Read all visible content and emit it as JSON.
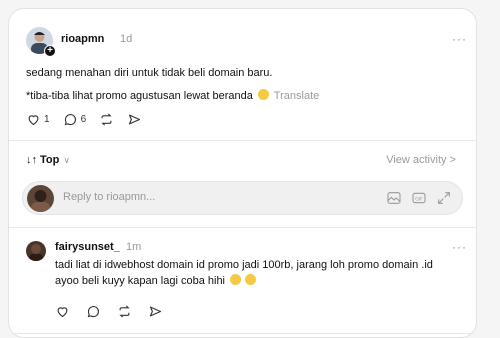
{
  "post": {
    "username": "rioapmn",
    "time": "1d",
    "more": "···",
    "line1": "sedang menahan diri untuk tidak beli domain baru.",
    "line2": "*tiba-tiba lihat promo agustusan lewat beranda",
    "translate": "Translate",
    "likes": "1",
    "comments": "6"
  },
  "sort": {
    "label": "Top",
    "arrows": "↓↑"
  },
  "view_activity": "View activity >",
  "reply": {
    "placeholder": "Reply to rioapmn..."
  },
  "comment": {
    "username": "fairysunset_",
    "time": "1m",
    "more": "···",
    "line1": "tadi liat di idwebhost domain id promo jadi 100rb, jarang loh promo domain .id",
    "line2": "ayoo beli kuyy kapan lagi coba hihi"
  },
  "colors": {
    "muted": "#9a9a9a",
    "divider": "#e8e8e8",
    "emoji": "#f6c944"
  }
}
